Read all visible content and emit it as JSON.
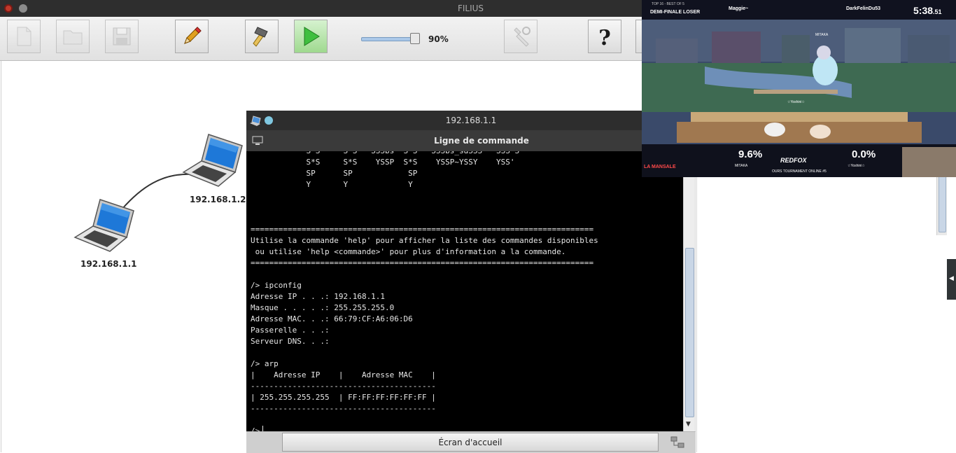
{
  "app": {
    "title": "FILIUS"
  },
  "toolbar": {
    "zoom_label": "90%",
    "zoom_level": 0.9,
    "buttons": [
      {
        "name": "new-button",
        "icon": "new-file-icon",
        "enabled": false
      },
      {
        "name": "open-button",
        "icon": "folder-icon",
        "enabled": false
      },
      {
        "name": "save-button",
        "icon": "floppy-disk-icon",
        "enabled": false
      },
      {
        "name": "design-mode-button",
        "icon": "pencil-icon",
        "enabled": true
      },
      {
        "name": "hammer-button",
        "icon": "hammer-icon",
        "enabled": true
      },
      {
        "name": "run-button",
        "icon": "play-icon",
        "enabled": true
      },
      {
        "name": "documentation-button",
        "icon": "tools-icon",
        "enabled": false
      },
      {
        "name": "help-button",
        "icon": "question-mark-icon",
        "enabled": true
      }
    ]
  },
  "network": {
    "nodes": [
      {
        "label": "192.168.1.1",
        "icon": "laptop-icon"
      },
      {
        "label": "192.168.1.2",
        "icon": "laptop-icon"
      }
    ]
  },
  "terminal": {
    "window_title": "192.168.1.1",
    "tab_label": "Ligne de commande",
    "home_button_label": "Écran d'accueil",
    "lines": [
      "            S*S     S*S   SSSbs  S*S   SSSbs_sdSSS   SSS*S",
      "            S*S     S*S    YSSP  S*S    YSSP~YSSY    YSS'",
      "            SP      SP            SP",
      "            Y       Y             Y",
      "",
      "",
      "",
      "==========================================================================",
      "Utilise la commande 'help' pour afficher la liste des commandes disponibles",
      " ou utilise 'help <commande>' pour plus d'information a la commande.",
      "==========================================================================",
      "",
      "/> ipconfig",
      "Adresse IP . . .: 192.168.1.1",
      "Masque . . . . .: 255.255.255.0",
      "Adresse MAC. . .: 66:79:CF:A6:06:D6",
      "Passerelle . . .:",
      "Serveur DNS. . .:",
      "",
      "/> arp",
      "|    Adresse IP    |    Adresse MAC    |",
      "----------------------------------------",
      "| 255.255.255.255  | FF:FF:FF:FF:FF:FF |",
      "----------------------------------------",
      ""
    ],
    "prompt": "/>"
  },
  "video_overlay": {
    "round": "TOP 16 - BEST OF 5",
    "stage": "DEMI-FINALE LOSER",
    "player_left": "Maggie~",
    "player_right": "DarkFelinDu53",
    "timer": "5:38",
    "timer_centis": ".51",
    "fighter_left_name": "MITAKA",
    "fighter_left_damage": "9.6%",
    "fighter_right_name": "☆Yoshini☆",
    "fighter_right_damage": "0.0%",
    "tournament": "OURS TOURNAMENT ONLINE #5",
    "sponsor": "REDFOX",
    "left_brand": "LA MANSALE",
    "nametag_stage": "MITAKA",
    "nametag_player": "☆Yoshini☆"
  }
}
